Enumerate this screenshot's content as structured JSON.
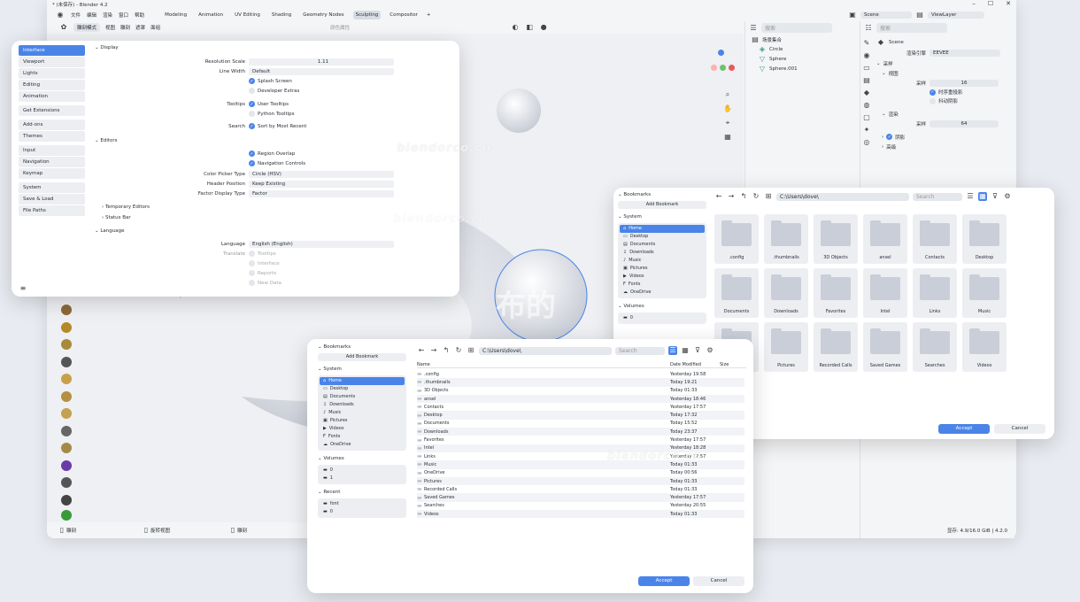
{
  "app": {
    "title": "* (未保存) - Blender 4.2",
    "menu": [
      "文件",
      "编辑",
      "渲染",
      "窗口",
      "帮助"
    ],
    "workspaces": [
      "Modeling",
      "Animation",
      "UV Editing",
      "Shading",
      "Geometry Nodes",
      "Sculpting",
      "Compositor"
    ],
    "active_workspace": "Sculpting",
    "add_workspace": "+",
    "scene_label": "Scene",
    "viewlayer_label": "ViewLayer"
  },
  "toolbar": {
    "mode": "雕刻模式",
    "menus": [
      "视图",
      "雕刻",
      "遮罩",
      "面组"
    ],
    "brush": "SculptDraw",
    "color_attr": "颜色属性",
    "xyz": [
      "X",
      "Y",
      "Z"
    ],
    "dyntopo": "动态拓扑",
    "remesh": "重构网格",
    "options": "选项",
    "brush_settings": [
      "笔刷",
      "纹理",
      "笔画",
      "衰减",
      "游标"
    ],
    "blue_btn": "强度/力度",
    "new_btn": "新建"
  },
  "outliner": {
    "search": "搜索",
    "items": [
      "场景集合",
      "Circle",
      "Sphere",
      "Sphere.001"
    ]
  },
  "properties": {
    "scene": "Scene",
    "render_engine_label": "渲染引擎",
    "render_engine": "EEVEE",
    "sampling": "采样",
    "viewport": "视图",
    "samples_label": "采样",
    "viewport_samples": "16",
    "temporal": "时序重投影",
    "jitter": "抖动阴影",
    "render": "渲染",
    "render_samples": "64",
    "shadows": "阴影",
    "advanced": "高级"
  },
  "statusbar": {
    "left": [
      "雕刻",
      "旋转视图",
      "雕刻"
    ],
    "right": "显存: 4.9/16.0 GiB | 4.2.0"
  },
  "prefs": {
    "sidebar": [
      [
        "Interface",
        "Viewport",
        "Lights",
        "Editing",
        "Animation"
      ],
      [
        "Get Extensions"
      ],
      [
        "Add-ons",
        "Themes"
      ],
      [
        "Input",
        "Navigation",
        "Keymap"
      ],
      [
        "System",
        "Save & Load",
        "File Paths"
      ]
    ],
    "display": "Display",
    "resolution_scale_label": "Resolution Scale",
    "resolution_scale": "1.11",
    "line_width_label": "Line Width",
    "line_width": "Default",
    "splash": "Splash Screen",
    "dev_extras": "Developer Extras",
    "tooltips_label": "Tooltips",
    "user_tooltips": "User Tooltips",
    "python_tooltips": "Python Tooltips",
    "search_label": "Search",
    "sort_recent": "Sort by Most Recent",
    "editors": "Editors",
    "region_overlap": "Region Overlap",
    "nav_controls": "Navigation Controls",
    "color_picker_label": "Color Picker Type",
    "color_picker": "Circle (HSV)",
    "header_pos_label": "Header Position",
    "header_pos": "Keep Existing",
    "factor_label": "Factor Display Type",
    "factor": "Factor",
    "temp_editors": "Temporary Editors",
    "status_bar": "Status Bar",
    "language_section": "Language",
    "language_label": "Language",
    "language": "English (English)",
    "translate_label": "Translate",
    "tr_tooltips": "Tooltips",
    "tr_interface": "Interface",
    "tr_reports": "Reports",
    "tr_newdata": "New Data"
  },
  "fb_common": {
    "bookmarks": "Bookmarks",
    "add_bookmark": "Add Bookmark",
    "system": "System",
    "system_items": [
      "Home",
      "Desktop",
      "Documents",
      "Downloads",
      "Music",
      "Pictures",
      "Videos",
      "Fonts",
      "OneDrive"
    ],
    "volumes": "Volumes",
    "path": "C:\\Users\\dove\\",
    "search": "Search",
    "accept": "Accept",
    "cancel": "Cancel"
  },
  "fb_grid": {
    "volumes": [
      "0"
    ],
    "folders": [
      ".config",
      ".thumbnails",
      "3D Objects",
      "ansel",
      "Contacts",
      "Desktop",
      "Documents",
      "Downloads",
      "Favorites",
      "Intel",
      "Links",
      "Music",
      "OneDrive",
      "Pictures",
      "Recorded Calls",
      "Saved Games",
      "Searches",
      "Videos"
    ]
  },
  "fb_list": {
    "volumes": [
      "0",
      "1"
    ],
    "recent": "Recent",
    "recent_items": [
      "font",
      "0"
    ],
    "col_name": "Name",
    "col_date": "Date Modified",
    "col_size": "Size",
    "rows": [
      [
        ".config",
        "Yesterday 19:58"
      ],
      [
        ".thumbnails",
        "Today 19:21"
      ],
      [
        "3D Objects",
        "Today 01:33"
      ],
      [
        "ansel",
        "Yesterday 18:46"
      ],
      [
        "Contacts",
        "Yesterday 17:57"
      ],
      [
        "Desktop",
        "Today 17:32"
      ],
      [
        "Documents",
        "Today 15:52"
      ],
      [
        "Downloads",
        "Today 23:37"
      ],
      [
        "Favorites",
        "Yesterday 17:57"
      ],
      [
        "Intel",
        "Yesterday 18:28"
      ],
      [
        "Links",
        "Yesterday 17:57"
      ],
      [
        "Music",
        "Today 01:33"
      ],
      [
        "OneDrive",
        "Today 00:56"
      ],
      [
        "Pictures",
        "Today 01:33"
      ],
      [
        "Recorded Calls",
        "Today 01:33"
      ],
      [
        "Saved Games",
        "Yesterday 17:57"
      ],
      [
        "Searches",
        "Yesterday 20:55"
      ],
      [
        "Videos",
        "Today 01:33"
      ]
    ]
  },
  "watermarks": [
    "blendorco.cn",
    "blendorco.cn",
    "blendorco.cn"
  ],
  "logo_text": "布的",
  "colors": {
    "accent": "#4a84e8",
    "bg": "#e8ebf1"
  }
}
